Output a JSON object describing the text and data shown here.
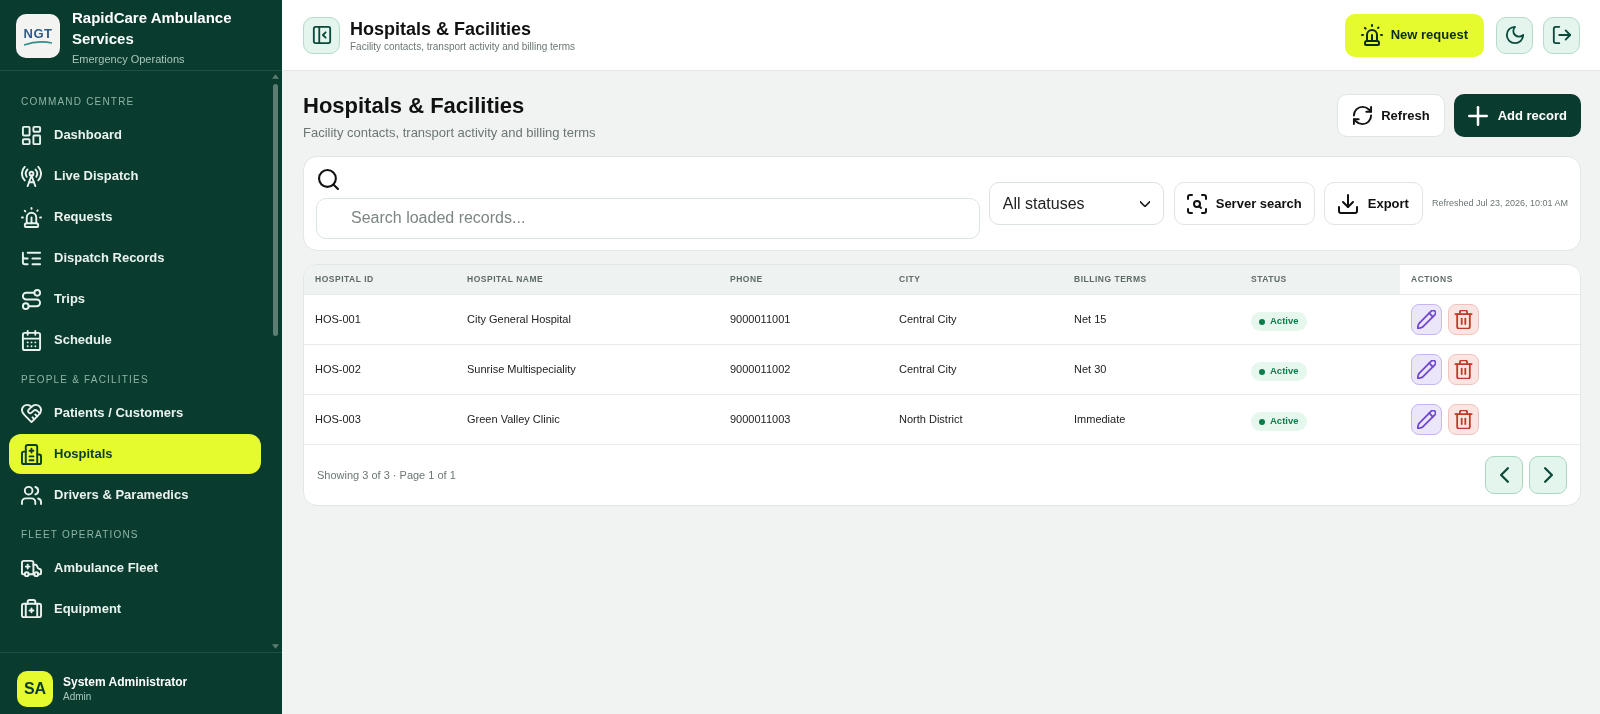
{
  "sidebar": {
    "logo_text": "NGT",
    "title": "RapidCare Ambulance Services",
    "subtitle": "Emergency Operations",
    "sections": [
      {
        "heading": "COMMAND CENTRE",
        "items": [
          {
            "label": "Dashboard",
            "selected": false
          },
          {
            "label": "Live Dispatch",
            "selected": false
          },
          {
            "label": "Requests",
            "selected": false
          },
          {
            "label": "Dispatch Records",
            "selected": false
          },
          {
            "label": "Trips",
            "selected": false
          },
          {
            "label": "Schedule",
            "selected": false
          }
        ]
      },
      {
        "heading": "PEOPLE & FACILITIES",
        "items": [
          {
            "label": "Patients / Customers",
            "selected": false
          },
          {
            "label": "Hospitals",
            "selected": true
          },
          {
            "label": "Drivers & Paramedics",
            "selected": false
          }
        ]
      },
      {
        "heading": "FLEET OPERATIONS",
        "items": [
          {
            "label": "Ambulance Fleet",
            "selected": false
          },
          {
            "label": "Equipment",
            "selected": false
          }
        ]
      }
    ],
    "user": {
      "initials": "SA",
      "name": "System Administrator",
      "role": "Admin"
    }
  },
  "topbar": {
    "title": "Hospitals & Facilities",
    "subtitle": "Facility contacts, transport activity and billing terms",
    "new_request": "New request"
  },
  "page": {
    "title": "Hospitals & Facilities",
    "subtitle": "Facility contacts, transport activity and billing terms",
    "refresh": "Refresh",
    "add_record": "Add record"
  },
  "filters": {
    "search": {
      "placeholder": "Search loaded records..."
    },
    "status_filter": {
      "value": "All statuses"
    },
    "server_search": "Server search",
    "export": "Export",
    "refreshed": "Refreshed Jul 23, 2026, 10:01 AM"
  },
  "table": {
    "columns": [
      "HOSPITAL ID",
      "HOSPITAL NAME",
      "PHONE",
      "CITY",
      "BILLING TERMS",
      "STATUS",
      "ACTIONS"
    ],
    "rows": [
      {
        "hospital_id": "HOS-001",
        "hospital_name": "City General Hospital",
        "phone": "9000011001",
        "city": "Central City",
        "billing_terms": "Net 15",
        "status": "Active"
      },
      {
        "hospital_id": "HOS-002",
        "hospital_name": "Sunrise Multispeciality",
        "phone": "9000011002",
        "city": "Central City",
        "billing_terms": "Net 30",
        "status": "Active"
      },
      {
        "hospital_id": "HOS-003",
        "hospital_name": "Green Valley Clinic",
        "phone": "9000011003",
        "city": "North District",
        "billing_terms": "Immediate",
        "status": "Active"
      }
    ],
    "footer": "Showing 3 of 3 · Page 1 of 1"
  }
}
